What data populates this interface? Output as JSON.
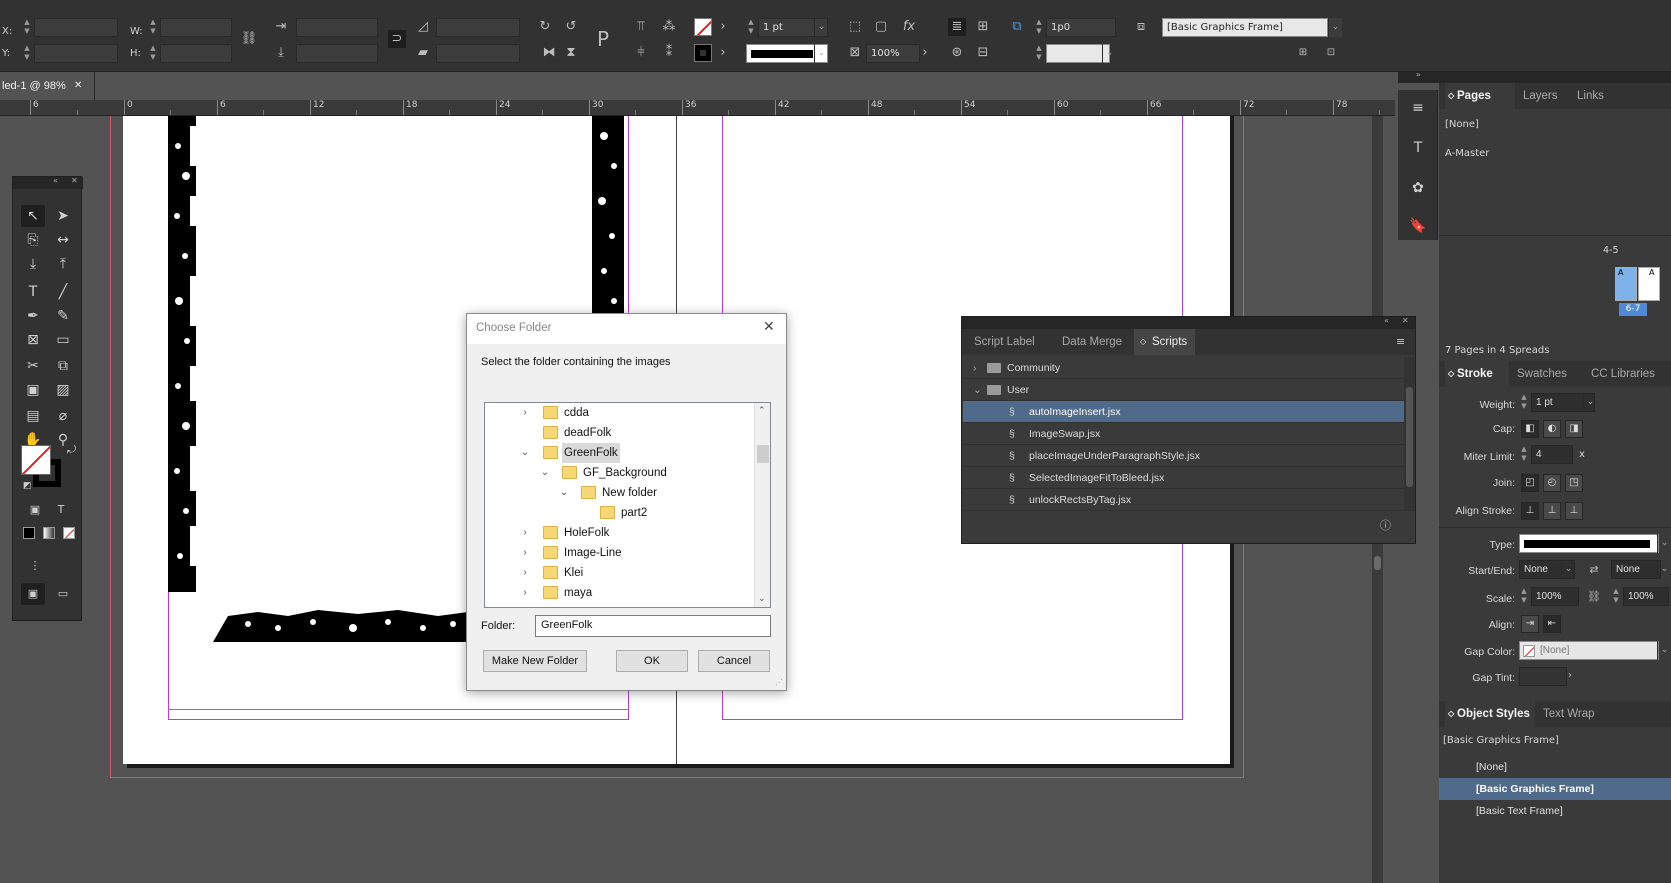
{
  "control_bar": {
    "x_label": "X:",
    "y_label": "Y:",
    "w_label": "W:",
    "h_label": "H:",
    "stroke_weight": "1 pt",
    "opacity": "100%",
    "offset": "1p0",
    "object_style": "[Basic Graphics Frame]"
  },
  "document_tab": {
    "title": "led-1 @ 98%",
    "close": "✕"
  },
  "ruler": {
    "labels": [
      "6",
      "0",
      "6",
      "12",
      "18",
      "24",
      "30",
      "36",
      "42",
      "48",
      "54",
      "60",
      "66",
      "72",
      "78"
    ]
  },
  "dialog": {
    "title": "Choose Folder",
    "instruction": "Select the folder containing the images",
    "tree": [
      {
        "name": "cdda",
        "level": 0,
        "expander": "›"
      },
      {
        "name": "deadFolk",
        "level": 0,
        "expander": ""
      },
      {
        "name": "GreenFolk",
        "level": 0,
        "expander": "⌄",
        "selected": true
      },
      {
        "name": "GF_Background",
        "level": 1,
        "expander": "⌄"
      },
      {
        "name": "New folder",
        "level": 2,
        "expander": "⌄"
      },
      {
        "name": "part2",
        "level": 3,
        "expander": ""
      },
      {
        "name": "HoleFolk",
        "level": 0,
        "expander": "›"
      },
      {
        "name": "Image-Line",
        "level": 0,
        "expander": "›"
      },
      {
        "name": "Klei",
        "level": 0,
        "expander": "›"
      },
      {
        "name": "maya",
        "level": 0,
        "expander": "›"
      }
    ],
    "folder_label": "Folder:",
    "folder_value": "GreenFolk",
    "make_new_folder": "Make New Folder",
    "ok": "OK",
    "cancel": "Cancel"
  },
  "scripts_panel": {
    "tabs": [
      "Script Label",
      "Data Merge",
      "Scripts"
    ],
    "active_tab": "Scripts",
    "folders": [
      "Community",
      "User"
    ],
    "scripts": [
      "autoImageInsert.jsx",
      "ImageSwap.jsx",
      "placeImageUnderParagraphStyle.jsx",
      "SelectedImageFitToBleed.jsx",
      "unlockRectsByTag.jsx"
    ],
    "selected_script": "autoImageInsert.jsx"
  },
  "pages_panel": {
    "tabs": [
      "Pages",
      "Layers",
      "Links"
    ],
    "none_master": "[None]",
    "a_master": "A-Master",
    "spread_top": "4-5",
    "spread_selected": "6-7",
    "page_letter": "A",
    "summary": "7 Pages in 4 Spreads"
  },
  "stroke_panel": {
    "tabs": [
      "Stroke",
      "Swatches",
      "CC Libraries"
    ],
    "weight_label": "Weight:",
    "weight_value": "1 pt",
    "cap_label": "Cap:",
    "miter_label": "Miter Limit:",
    "miter_value": "4",
    "miter_unit": "x",
    "join_label": "Join:",
    "align_stroke_label": "Align Stroke:",
    "type_label": "Type:",
    "start_end_label": "Start/End:",
    "start_value": "None",
    "end_value": "None",
    "scale_label": "Scale:",
    "scale_start": "100%",
    "scale_end": "100%",
    "align_label": "Align:",
    "gap_color_label": "Gap Color:",
    "gap_color_value": "[None]",
    "gap_tint_label": "Gap Tint:"
  },
  "object_styles_panel": {
    "tabs": [
      "Object Styles",
      "Text Wrap"
    ],
    "current": "[Basic Graphics Frame]",
    "items": [
      "[None]",
      "[Basic Graphics Frame]",
      "[Basic Text Frame]"
    ],
    "selected": "[Basic Graphics Frame]"
  },
  "colors": {
    "ui_dark": "#323232",
    "panel": "#3a3a3a",
    "selection": "#4f6a8a",
    "margin_guide": "#b63fd0",
    "bleed_guide": "#e0506a"
  }
}
